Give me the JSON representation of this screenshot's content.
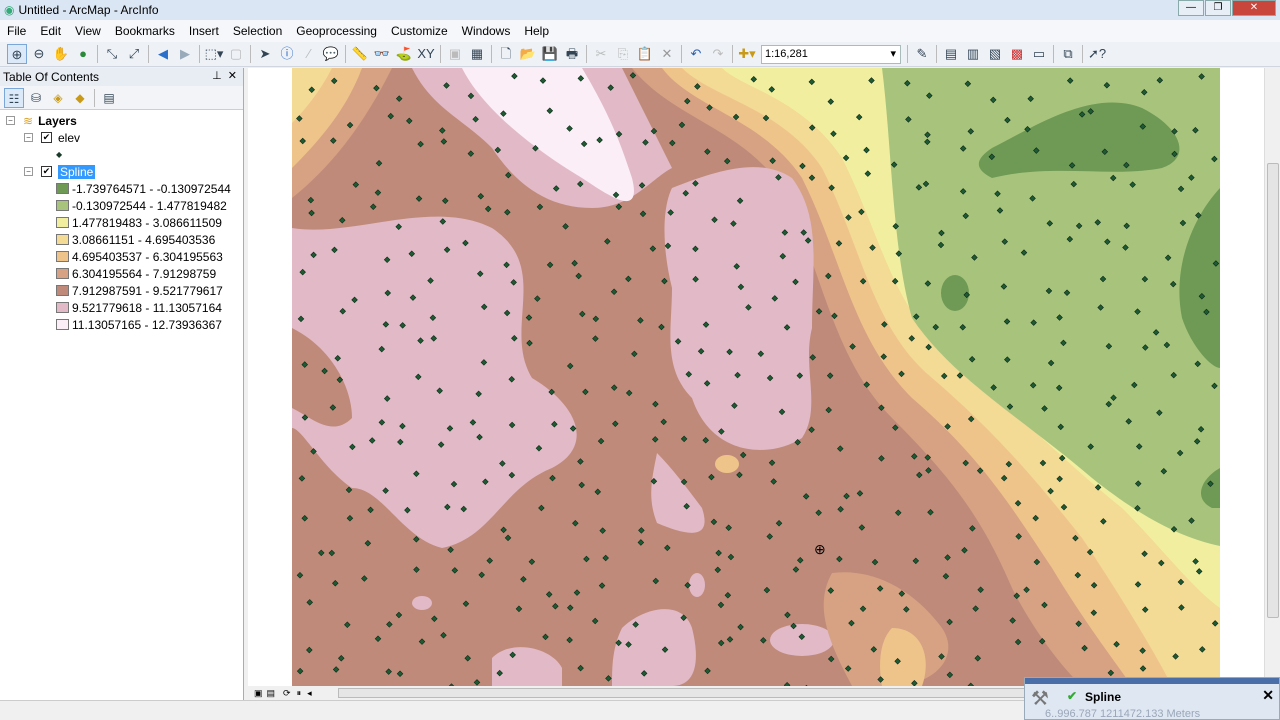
{
  "window": {
    "title": "Untitled - ArcMap - ArcInfo"
  },
  "menu": [
    "File",
    "Edit",
    "View",
    "Bookmarks",
    "Insert",
    "Selection",
    "Geoprocessing",
    "Customize",
    "Windows",
    "Help"
  ],
  "toolbar": {
    "scale": "1:16,281"
  },
  "toc": {
    "title": "Table Of Contents",
    "root": "Layers",
    "layers": [
      {
        "name": "elev",
        "checked": true
      },
      {
        "name": "Spline",
        "checked": true,
        "selected": true
      }
    ],
    "legend": [
      {
        "label": "-1.739764571 - -0.130972544",
        "color": "#6f9a55"
      },
      {
        "label": "-0.130972544 - 1.477819482",
        "color": "#a8c47c"
      },
      {
        "label": "1.477819483 - 3.086611509",
        "color": "#f1ef9f"
      },
      {
        "label": "3.08661151 - 4.695403536",
        "color": "#f3da95"
      },
      {
        "label": "4.695403537 - 6.304195563",
        "color": "#eec48a"
      },
      {
        "label": "6.304195564 - 7.91298759",
        "color": "#d6a283"
      },
      {
        "label": "7.912987591 - 9.521779617",
        "color": "#bf8a79"
      },
      {
        "label": "9.521779618 - 11.13057164",
        "color": "#e2b9c6"
      },
      {
        "label": "11.13057165 - 12.73936367",
        "color": "#fbeef6"
      }
    ]
  },
  "popup": {
    "title": "Spline",
    "coords": "6..996.787  1211472.133 Meters"
  }
}
